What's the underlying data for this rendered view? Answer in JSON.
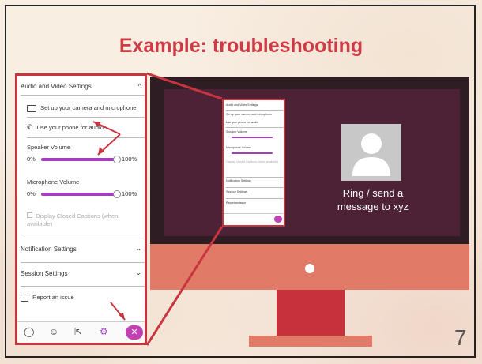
{
  "slide": {
    "title": "Example: troubleshooting",
    "number": "7"
  },
  "panel": {
    "audio_video_title": "Audio and Video Settings",
    "camera_setup": "Set up your camera and microphone",
    "phone_audio": "Use your phone for audio",
    "speaker_label": "Speaker Volume",
    "speaker_min": "0%",
    "speaker_max": "100%",
    "speaker_level": 1.0,
    "mic_label": "Microphone Volume",
    "mic_min": "0%",
    "mic_max": "100%",
    "mic_level": 1.0,
    "captions": "Display Closed Captions (when available)",
    "notification_title": "Notification Settings",
    "session_title": "Session Settings",
    "report_issue": "Report an issue",
    "chevron_up": "^",
    "chevron_down": "⌄",
    "close": "✕"
  },
  "monitor": {
    "caller_text": "Ring / send a message to xyz"
  },
  "colors": {
    "title": "#cd3b47",
    "accent_red": "#c9353f",
    "slider": "#a43fc0",
    "screen": "#4e2236",
    "stand": "#e27a68"
  }
}
